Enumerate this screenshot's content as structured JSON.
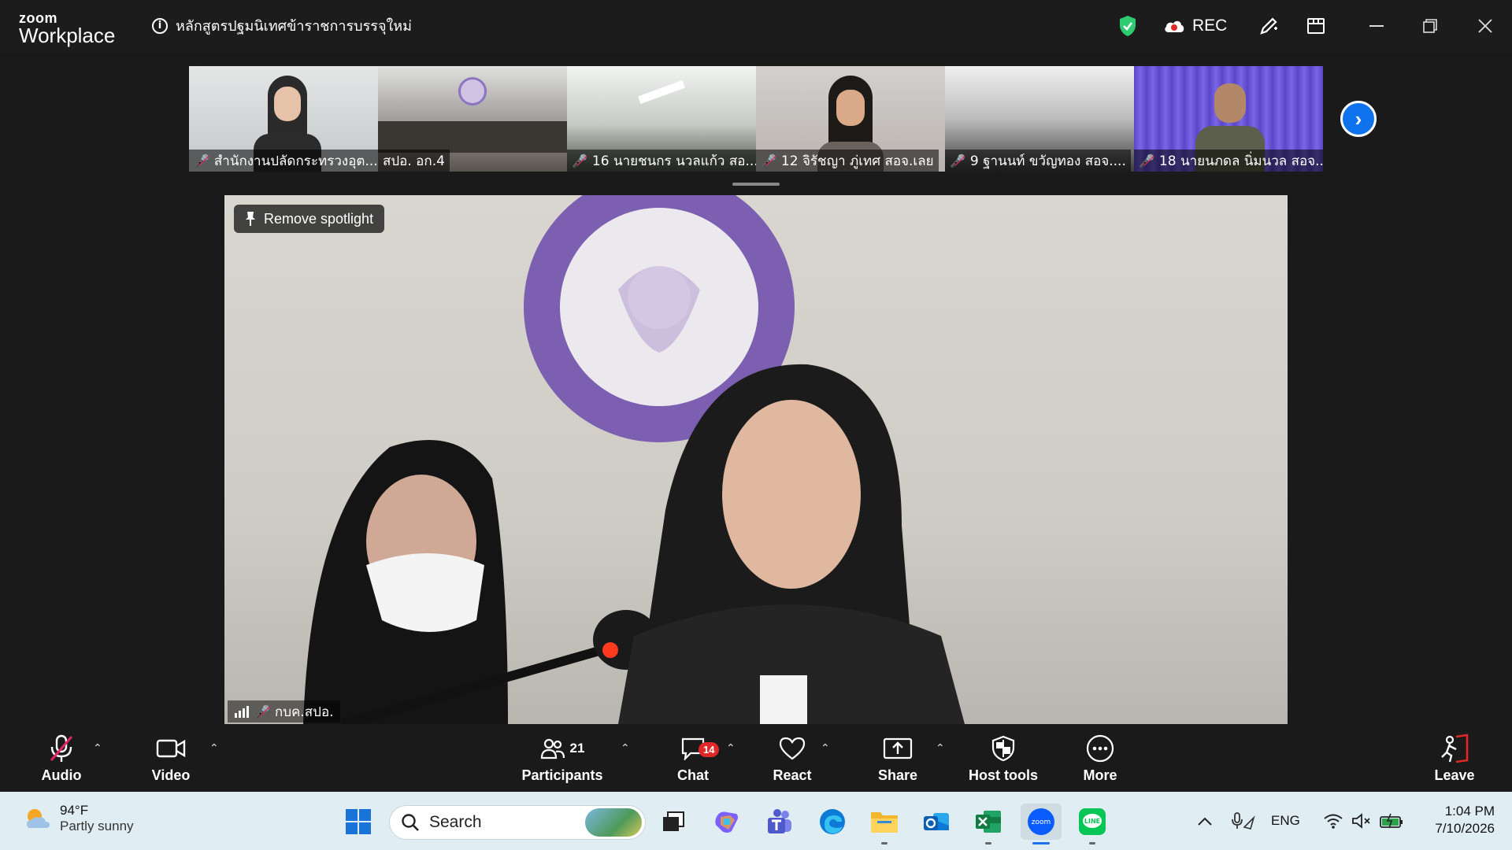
{
  "app": {
    "logo_top": "zoom",
    "logo_bottom": "Workplace",
    "meeting_title": "หลักสูตรปฐมนิเทศข้าราชการบรรจุใหม่",
    "rec_label": "REC"
  },
  "thumbnails": [
    {
      "name": "สำนักงานปลัดกระทรวงอุต...",
      "bg": "#cfd4d8"
    },
    {
      "name": "สปอ. อก.4",
      "bg": "#8d8a86"
    },
    {
      "name": "16 นายชนกร นวลแก้ว สอ...",
      "bg": "#c9cfc6"
    },
    {
      "name": "12 จิรัชญา ภู่เทศ สอจ.เลย",
      "bg": "#c7c2bf"
    },
    {
      "name": "9 ฐานนท์ ขวัญทอง สอจ....",
      "bg": "#b8b8b8"
    },
    {
      "name": "18 นายนภดล นิ่มนวล สอจ...",
      "bg": "#6f5bd6"
    }
  ],
  "main_video": {
    "spotlight_label": "Remove spotlight",
    "participant_name": "กบค.สปอ."
  },
  "toolbar": {
    "audio": "Audio",
    "video": "Video",
    "participants": "Participants",
    "participants_count": "21",
    "chat": "Chat",
    "chat_badge": "14",
    "react": "React",
    "share": "Share",
    "host_tools": "Host tools",
    "more": "More",
    "leave": "Leave"
  },
  "taskbar": {
    "temperature": "94°F",
    "weather_desc": "Partly sunny",
    "search_placeholder": "Search",
    "language": "ENG",
    "time": "1:04 PM",
    "date": "7/10/2026"
  },
  "colors": {
    "accent": "#0e72ed",
    "muted_red": "#e0245e",
    "shield_green": "#2ecc71",
    "chat_badge": "#e02828"
  }
}
